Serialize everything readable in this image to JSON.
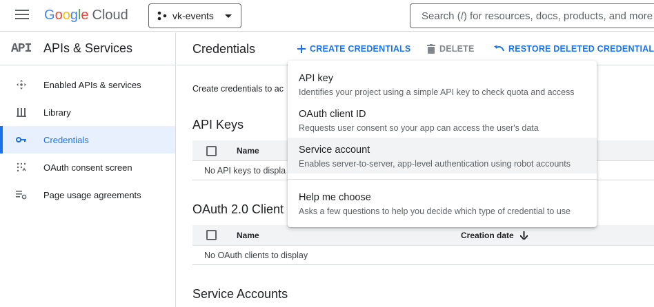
{
  "topbar": {
    "logo_g": "G",
    "logo_o1": "o",
    "logo_o2": "o",
    "logo_g2": "g",
    "logo_l": "l",
    "logo_e": "e",
    "logo_cloud": "Cloud",
    "project": "vk-events",
    "search_placeholder": "Search (/) for resources, docs, products, and more"
  },
  "sidebar": {
    "glyph": "API",
    "title": "APIs & Services",
    "items": [
      {
        "label": "Enabled APIs & services",
        "icon": "hub-icon"
      },
      {
        "label": "Library",
        "icon": "library-icon"
      },
      {
        "label": "Credentials",
        "icon": "key-icon",
        "active": true
      },
      {
        "label": "OAuth consent screen",
        "icon": "consent-icon"
      },
      {
        "label": "Page usage agreements",
        "icon": "settings-list-icon"
      }
    ]
  },
  "header": {
    "title": "Credentials",
    "create": "CREATE CREDENTIALS",
    "delete": "DELETE",
    "restore": "RESTORE DELETED CREDENTIALS"
  },
  "main": {
    "intro": "Create credentials to ac",
    "api_keys": {
      "title": "API Keys",
      "col_name": "Name",
      "empty": "No API keys to displa"
    },
    "oauth": {
      "title": "OAuth 2.0 Client I",
      "col_name": "Name",
      "col_date": "Creation date",
      "empty": "No OAuth clients to display"
    },
    "service_accounts": {
      "title": "Service Accounts"
    }
  },
  "menu": {
    "items": [
      {
        "title": "API key",
        "desc": "Identifies your project using a simple API key to check quota and access"
      },
      {
        "title": "OAuth client ID",
        "desc": "Requests user consent so your app can access the user's data"
      },
      {
        "title": "Service account",
        "desc": "Enables server-to-server, app-level authentication using robot accounts"
      },
      {
        "title": "Help me choose",
        "desc": "Asks a few questions to help you decide which type of credential to use"
      }
    ]
  },
  "colors": {
    "accent": "#1a73e8",
    "active_bg": "#e8f0fe",
    "border": "#dadce0"
  }
}
